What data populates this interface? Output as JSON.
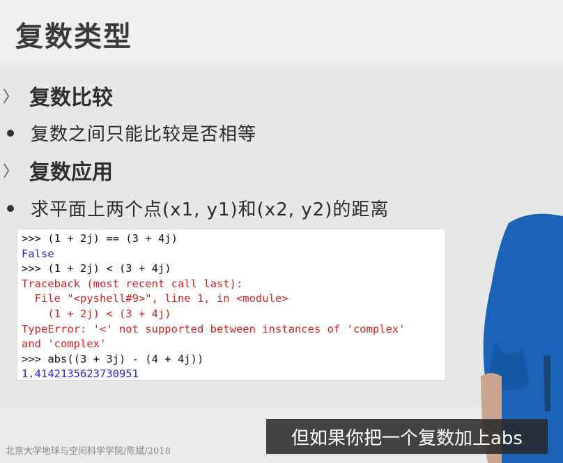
{
  "slide": {
    "title": "复数类型"
  },
  "sections": [
    {
      "heading": "复数比较",
      "bullet": "复数之间只能比较是否相等"
    },
    {
      "heading": "复数应用",
      "bullet": "求平面上两个点(x1, y1)和(x2, y2)的距离"
    }
  ],
  "code": {
    "lines": [
      ">>> (1 + 2j) == (3 + 4j)",
      "False",
      ">>> (1 + 2j) < (3 + 4j)",
      "Traceback (most recent call last):",
      "  File \"<pyshell#9>\", line 1, in <module>",
      "    (1 + 2j) < (3 + 4j)",
      "TypeError: '<' not supported between instances of 'complex'",
      "and 'complex'",
      ">>> abs((3 + 3j) - (4 + 4j))",
      "1.4142135623730951"
    ]
  },
  "footer": "北京大学地球与空间科学学院/陈斌/2018",
  "subtitle": "但如果你把一个复数加上abs",
  "colors": {
    "prompt": "#111111",
    "output": "#2323d8",
    "error": "#d62020"
  }
}
